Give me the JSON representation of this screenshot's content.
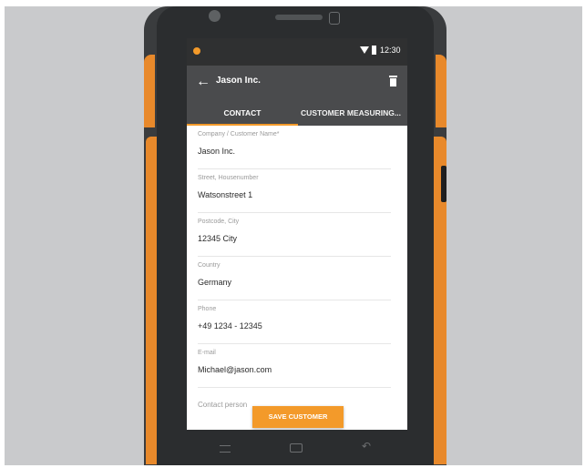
{
  "status_bar": {
    "time": "12:30"
  },
  "app_bar": {
    "title": "Jason Inc."
  },
  "tabs": [
    {
      "label": "CONTACT",
      "selected": true
    },
    {
      "label": "CUSTOMER MEASURING..."
    }
  ],
  "fields": [
    {
      "label": "Company / Customer Name*",
      "value": "Jason Inc."
    },
    {
      "label": "Street, Housenumber",
      "value": "Watsonstreet 1"
    },
    {
      "label": "Postcode, City",
      "value": "12345 City"
    },
    {
      "label": "Country",
      "value": "Germany"
    },
    {
      "label": "Phone",
      "value": "+49 1234 - 12345"
    },
    {
      "label": "E-mail",
      "value": "Michael@jason.com"
    }
  ],
  "contact_person_label": "Contact person",
  "save_button_label": "SAVE CUSTOMER",
  "colors": {
    "accent": "#f39a2a",
    "appbar": "#4a4b4d",
    "bumper": "#e8892b"
  },
  "icons": [
    "back-arrow-icon",
    "trash-icon",
    "wifi-icon",
    "battery-icon",
    "menu-icon",
    "home-icon",
    "back-icon"
  ]
}
